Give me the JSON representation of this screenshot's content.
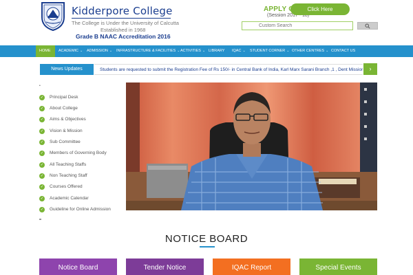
{
  "header": {
    "college_name": "Kidderpore College",
    "tagline": "The College is Under the University of Calcutta",
    "established": "Established in 1968",
    "grade": "Grade B NAAC Accreditation 2016",
    "apply_online": "APPLY ONLINE",
    "session": "(Session 2017 - 18)",
    "click_here": "Click Here"
  },
  "search": {
    "placeholder": "Custom Search"
  },
  "nav": {
    "items": [
      {
        "label": "HOME",
        "caret": ""
      },
      {
        "label": "ACADEMIC",
        "caret": "⌄"
      },
      {
        "label": "ADMISSION",
        "caret": "⌄"
      },
      {
        "label": "INFRASTRUCTURE & FACILITIES",
        "caret": "⌄"
      },
      {
        "label": "ACTIVITIES",
        "caret": "⌄"
      },
      {
        "label": "LIBRARY",
        "caret": ""
      },
      {
        "label": "IQAC",
        "caret": "⌄"
      },
      {
        "label": "STUDENT CORNER",
        "caret": "⌄"
      },
      {
        "label": "OTHER CENTRES",
        "caret": "⌄"
      },
      {
        "label": "CONTACT US",
        "caret": ""
      }
    ]
  },
  "news": {
    "label": "News Updates",
    "text": "Students are requested to submit the Registration Fee of Rs 150/- in Central Bank of India, Karl Marx Sarani Branch ,1 , Dent Mission",
    "next": "›"
  },
  "sidebar": {
    "items": [
      {
        "label": "Principal Desk"
      },
      {
        "label": "About College"
      },
      {
        "label": "Aims & Objectives"
      },
      {
        "label": "Vision & Mission"
      },
      {
        "label": "Sub Committee"
      },
      {
        "label": "Members of Governing Body"
      },
      {
        "label": "All Teaching Staffs"
      },
      {
        "label": "Non Teaching Staff"
      },
      {
        "label": "Courses Offered"
      },
      {
        "label": "Academic Calendar"
      },
      {
        "label": "Guideline for Online Admission"
      }
    ]
  },
  "notice": {
    "title": "NOTICE BOARD",
    "tiles": [
      {
        "label": "Notice Board",
        "color": "#8e44ad"
      },
      {
        "label": "Tender Notice",
        "color": "#7d3c98"
      },
      {
        "label": "IQAC Report",
        "color": "#f36f21"
      },
      {
        "label": "Special Events",
        "color": "#7ab534"
      }
    ]
  },
  "colors": {
    "brand_blue": "#2591cc",
    "brand_green": "#7ab534",
    "title_blue": "#1a3d8f"
  }
}
